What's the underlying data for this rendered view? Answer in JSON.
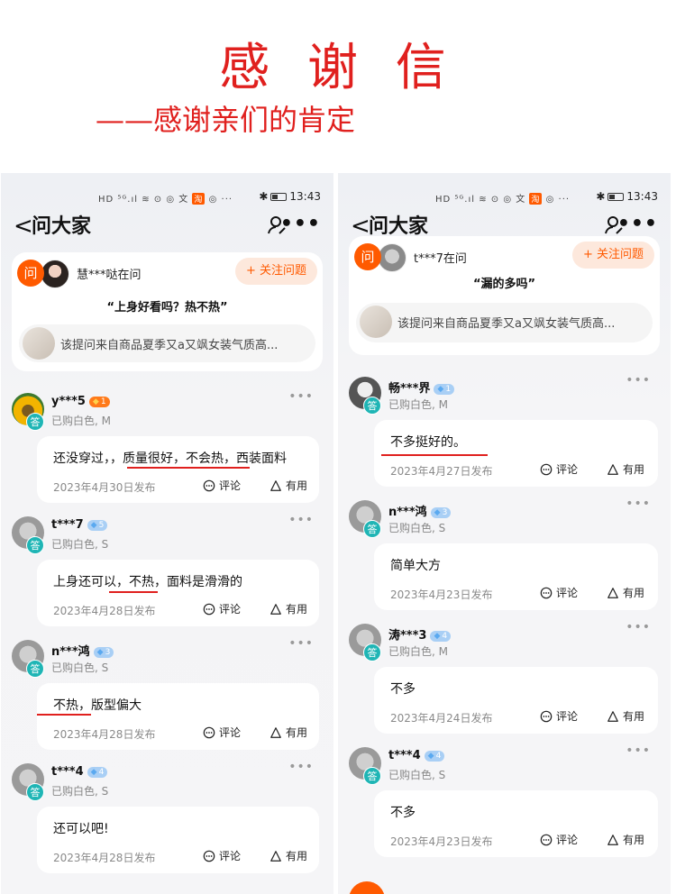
{
  "header": {
    "title": "感 谢 信",
    "subtitle": "——感谢亲们的肯定"
  },
  "status": {
    "icons": "HD ⁵ᴳ.ıl ≋ ⊙ ◎ 文",
    "taobao": "淘",
    "extra": "◎ ···",
    "time": "13:43"
  },
  "nav": {
    "back": "<",
    "title": "问大家",
    "more": "•••"
  },
  "left": {
    "question": {
      "badge": "问",
      "asker": "慧***哒在问",
      "follow": "+ 关注问题",
      "text": "“上身好看吗？热不热”",
      "product": "该提问来自商品夏季又a又飒女装气质高..."
    },
    "answers": [
      {
        "name": "y***5",
        "level": "1",
        "spec": "已购白色, M",
        "text": "还没穿过，，质量很好，不会热，西装面料",
        "date": "2023年4月30日发布",
        "comment": "评论",
        "useful": "有用"
      },
      {
        "name": "t***7",
        "level": "5",
        "spec": "已购白色, S",
        "text": "上身还可以，不热，面料是滑滑的",
        "date": "2023年4月28日发布",
        "comment": "评论",
        "useful": "有用"
      },
      {
        "name": "n***鸿",
        "level": "3",
        "spec": "已购白色, S",
        "text": "不热，版型偏大",
        "date": "2023年4月28日发布",
        "comment": "评论",
        "useful": "有用"
      },
      {
        "name": "t***4",
        "level": "4",
        "spec": "已购白色, S",
        "text": "还可以吧!",
        "date": "2023年4月28日发布",
        "comment": "评论",
        "useful": "有用"
      }
    ]
  },
  "right": {
    "question": {
      "badge": "问",
      "asker": "t***7在问",
      "follow": "+ 关注问题",
      "text": "“漏的多吗”",
      "product": "该提问来自商品夏季又a又飒女装气质高..."
    },
    "answers": [
      {
        "name": "畅***界",
        "level": "1",
        "spec": "已购白色, M",
        "text": "不多挺好的。",
        "date": "2023年4月27日发布",
        "comment": "评论",
        "useful": "有用"
      },
      {
        "name": "n***鸿",
        "level": "3",
        "spec": "已购白色, S",
        "text": "简单大方",
        "date": "2023年4月23日发布",
        "comment": "评论",
        "useful": "有用"
      },
      {
        "name": "涛***3",
        "level": "4",
        "spec": "已购白色, M",
        "text": "不多",
        "date": "2023年4月24日发布",
        "comment": "评论",
        "useful": "有用"
      },
      {
        "name": "t***4",
        "level": "4",
        "spec": "已购白色, S",
        "text": "不多",
        "date": "2023年4月23日发布",
        "comment": "评论",
        "useful": "有用"
      }
    ]
  },
  "answer_badge": "答",
  "colors": {
    "accent": "#e0201e",
    "brand": "#ff5a00",
    "answer_badge": "#1fb5b5"
  }
}
